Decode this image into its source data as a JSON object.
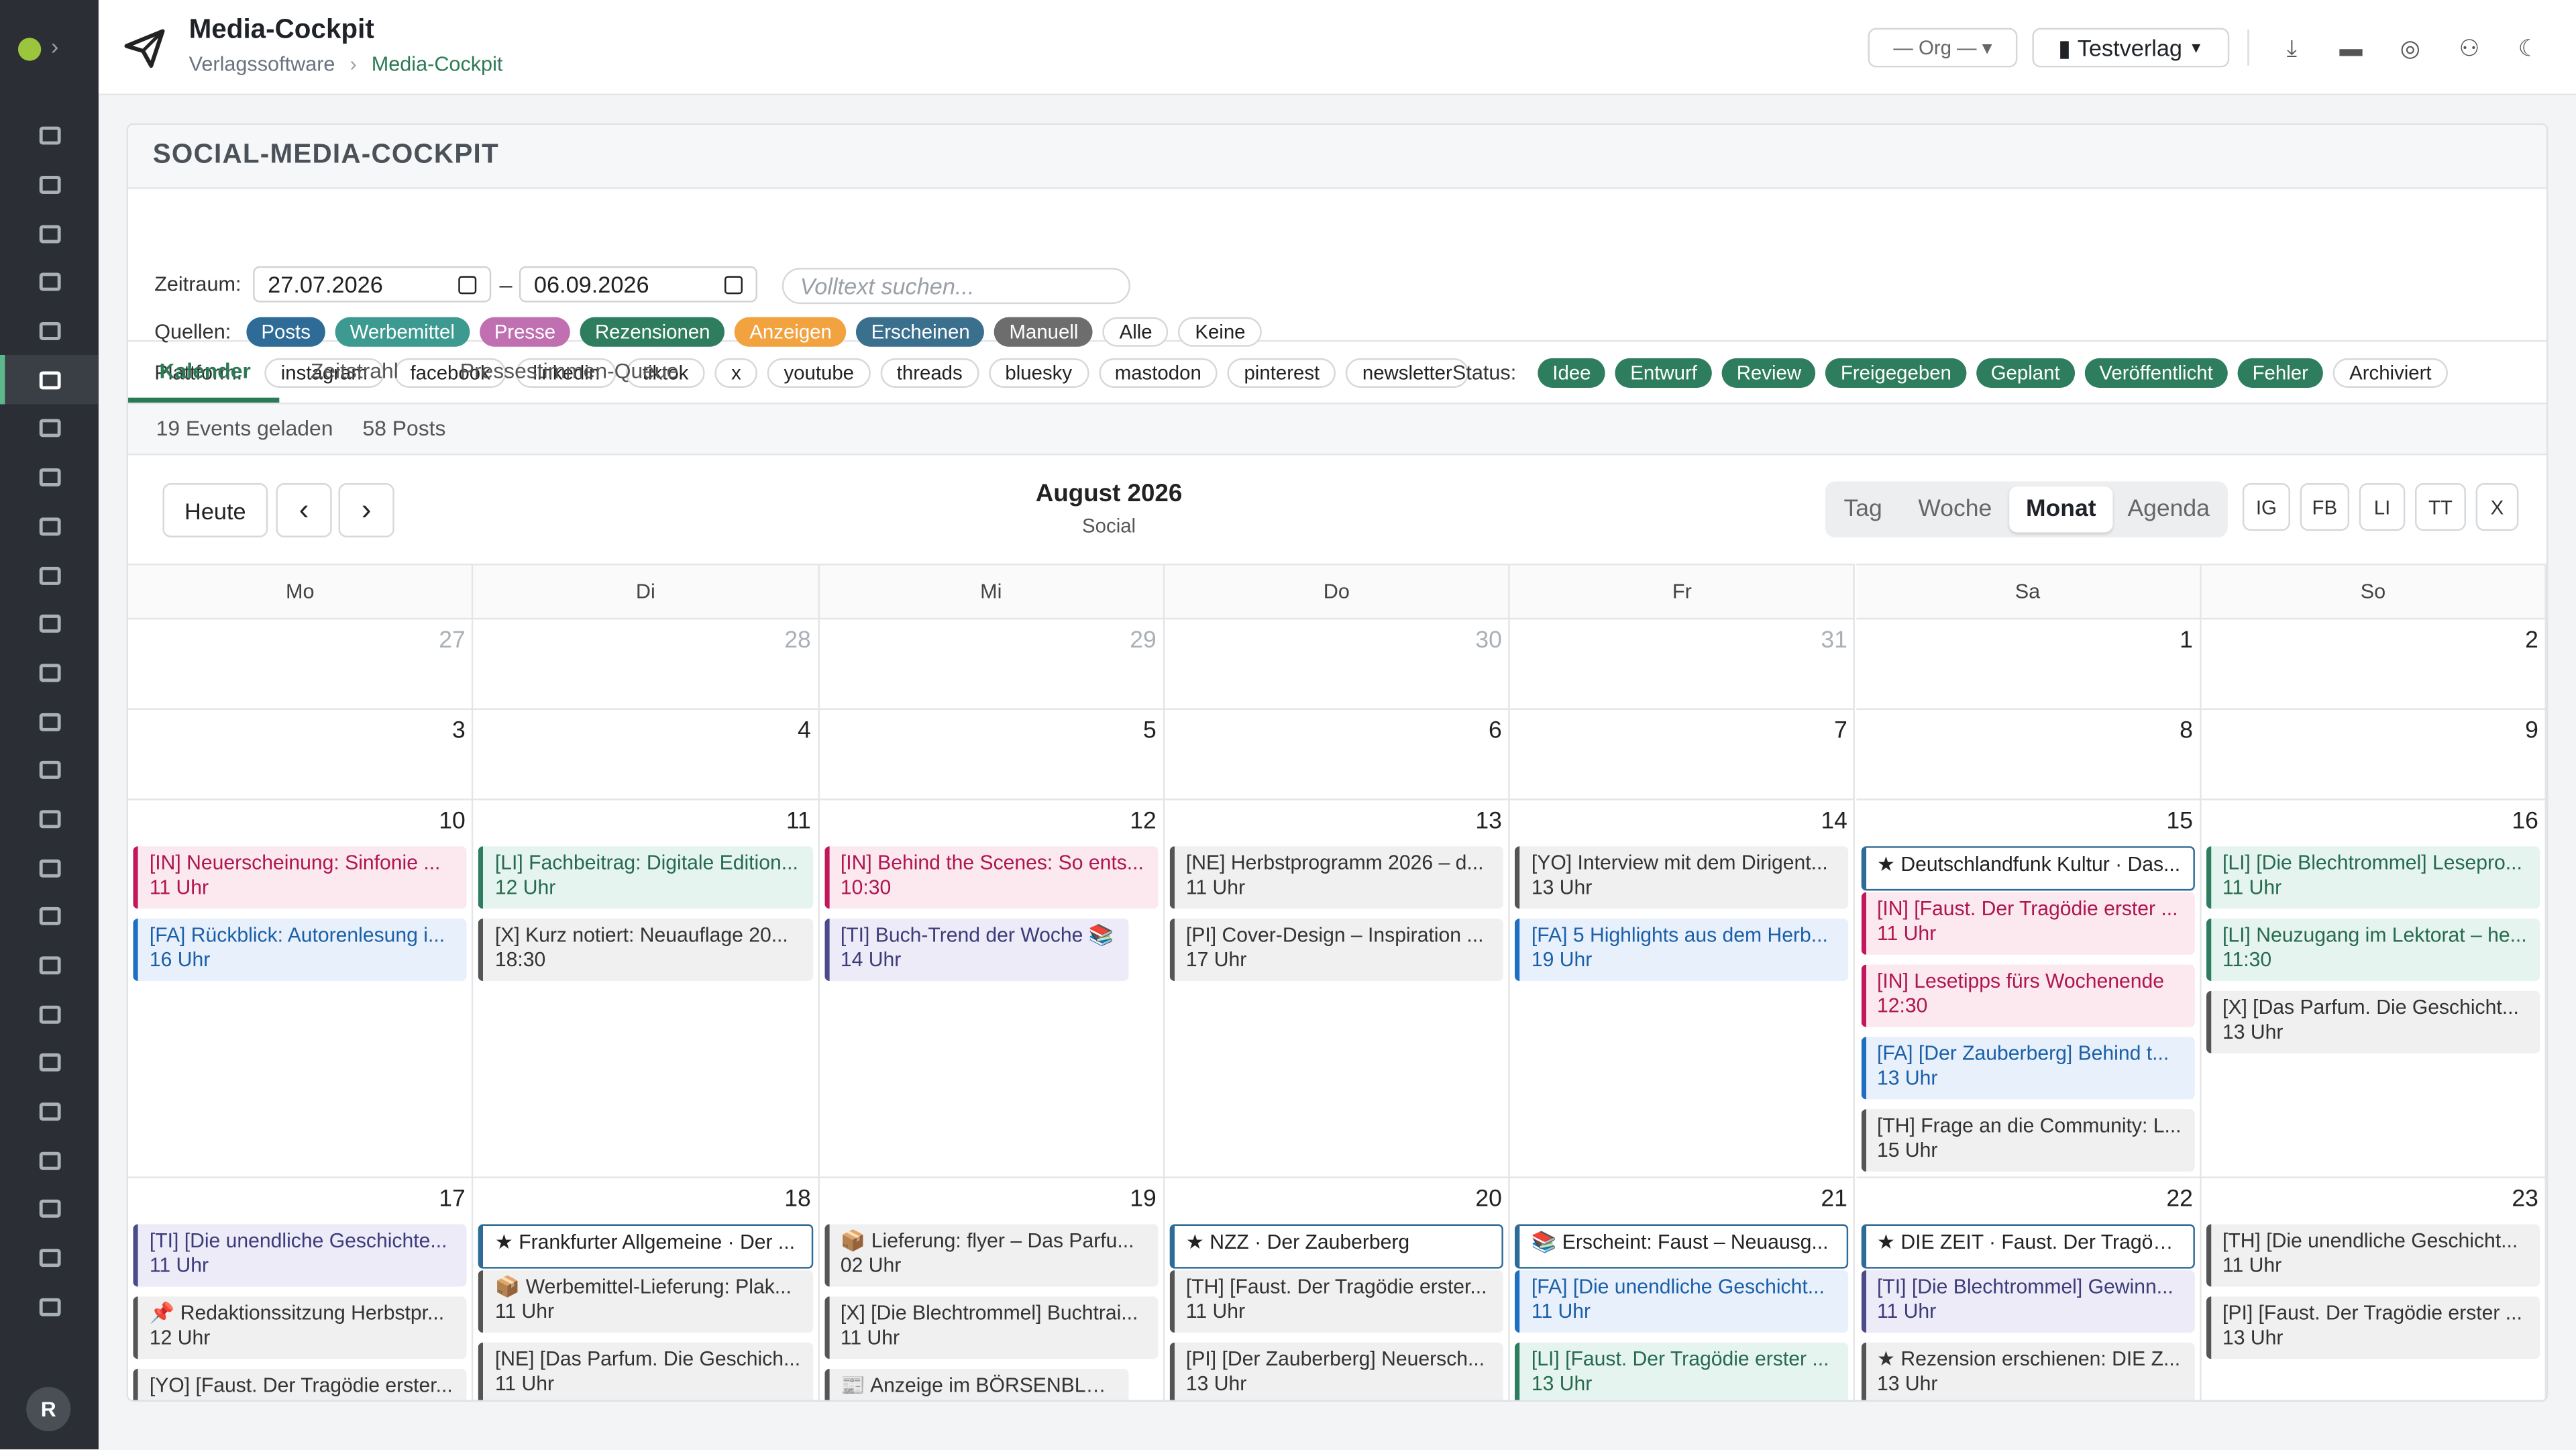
{
  "app": {
    "title": "Media-Cockpit",
    "breadcrumb": [
      "Verlagssoftware",
      "Media-Cockpit"
    ],
    "org_label": "— Org — ▾",
    "verlag_label": "Testverlag",
    "avatar": "R"
  },
  "card": {
    "title": "SOCIAL-MEDIA-COCKPIT"
  },
  "filters": {
    "zeitraum_label": "Zeitraum:",
    "date_from": "27.07.2026",
    "dash": "–",
    "date_to": "06.09.2026",
    "search_placeholder": "Volltext suchen...",
    "quellen_label": "Quellen:",
    "plattform_label": "Plattform:",
    "status_label": "Status:",
    "quellen": [
      {
        "label": "Posts",
        "color": "#2e6b96"
      },
      {
        "label": "Werbemittel",
        "color": "#3c9a90"
      },
      {
        "label": "Presse",
        "color": "#c06fb0"
      },
      {
        "label": "Rezensionen",
        "color": "#2f7d5f"
      },
      {
        "label": "Anzeigen",
        "color": "#f2a23f"
      },
      {
        "label": "Erscheinen",
        "color": "#3b6f8e"
      },
      {
        "label": "Manuell",
        "color": "#6d6d6d"
      }
    ],
    "quellen_extra": [
      "Alle",
      "Keine"
    ],
    "plattformen": [
      "instagram",
      "facebook",
      "linkedin",
      "tiktok",
      "x",
      "youtube",
      "threads",
      "bluesky",
      "mastodon",
      "pinterest",
      "newsletter"
    ],
    "status": [
      {
        "label": "Idee",
        "color": "#2f7d5f"
      },
      {
        "label": "Entwurf",
        "color": "#2f7d5f"
      },
      {
        "label": "Review",
        "color": "#2f7d5f"
      },
      {
        "label": "Freigegeben",
        "color": "#2f7d5f"
      },
      {
        "label": "Geplant",
        "color": "#2f7d5f"
      },
      {
        "label": "Veröffentlicht",
        "color": "#2f7d5f"
      },
      {
        "label": "Fehler",
        "color": "#2f7d5f"
      }
    ],
    "status_extra": [
      "Archiviert"
    ]
  },
  "tabs": [
    "Kalender",
    "Zeitstrahl",
    "Pressestimmen-Queue"
  ],
  "stats": {
    "events": "19 Events geladen",
    "posts": "58 Posts"
  },
  "calendar": {
    "today": "Heute",
    "prev": "‹",
    "next": "›",
    "month": "August 2026",
    "sub": "Social",
    "views": [
      "Tag",
      "Woche",
      "Monat",
      "Agenda"
    ],
    "platforms": [
      "IG",
      "FB",
      "LI",
      "TT",
      "X"
    ],
    "weekdays": [
      "Mo",
      "Di",
      "Mi",
      "Do",
      "Fr",
      "Sa",
      "So"
    ],
    "weeks": [
      [
        {
          "d": "27",
          "o": true
        },
        {
          "d": "28",
          "o": true
        },
        {
          "d": "29",
          "o": true
        },
        {
          "d": "30",
          "o": true
        },
        {
          "d": "31",
          "o": true
        },
        {
          "d": "1"
        },
        {
          "d": "2"
        }
      ],
      [
        {
          "d": "3"
        },
        {
          "d": "4"
        },
        {
          "d": "5"
        },
        {
          "d": "6"
        },
        {
          "d": "7"
        },
        {
          "d": "8"
        },
        {
          "d": "9"
        }
      ],
      [
        {
          "d": "10",
          "ev": [
            {
              "t": "[IN] Neuerscheinung: Sinfonie ...",
              "h": "11 Uhr",
              "c": "in"
            },
            {
              "t": "[FA] Rückblick: Autorenlesung i...",
              "h": "16 Uhr",
              "c": "fa"
            }
          ]
        },
        {
          "d": "11",
          "ev": [
            {
              "t": "[LI] Fachbeitrag: Digitale Edition...",
              "h": "12 Uhr",
              "c": "li"
            },
            {
              "t": "[X] Kurz notiert: Neuauflage 20...",
              "h": "18:30",
              "c": "gr"
            }
          ]
        },
        {
          "d": "12",
          "ev": [
            {
              "t": "[IN] Behind the Scenes: So ents...",
              "h": "10:30",
              "c": "in"
            },
            {
              "t": "[TI] Buch-Trend der Woche 📚",
              "h": "14 Uhr",
              "c": "ti",
              "w": 185
            }
          ]
        },
        {
          "d": "13",
          "ev": [
            {
              "t": "[NE] Herbstprogramm 2026 – d...",
              "h": "11 Uhr",
              "c": "gr"
            },
            {
              "t": "[PI] Cover-Design – Inspiration ...",
              "h": "17 Uhr",
              "c": "gr"
            }
          ]
        },
        {
          "d": "14",
          "ev": [
            {
              "t": "[YO] Interview mit dem Dirigent...",
              "h": "13 Uhr",
              "c": "gr"
            },
            {
              "t": "[FA] 5 Highlights aus dem Herb...",
              "h": "19 Uhr",
              "c": "fa"
            }
          ]
        },
        {
          "d": "15",
          "ev": [
            {
              "t": "★ Deutschlandfunk Kultur · Das...",
              "c": "hl"
            },
            {
              "t": "[IN] [Faust. Der Tragödie erster ...",
              "h": "11 Uhr",
              "c": "in"
            },
            {
              "t": "[IN] Lesetipps fürs Wochenende",
              "h": "12:30",
              "c": "in"
            },
            {
              "t": "[FA] [Der Zauberberg] Behind t...",
              "h": "13 Uhr",
              "c": "fa"
            },
            {
              "t": "[TH] Frage an die Community: L...",
              "h": "15 Uhr",
              "c": "gr"
            }
          ]
        },
        {
          "d": "16",
          "ev": [
            {
              "t": "[LI] [Die Blechtrommel] Lesepro...",
              "h": "11 Uhr",
              "c": "li"
            },
            {
              "t": "[LI] Neuzugang im Lektorat – he...",
              "h": "11:30",
              "c": "li"
            },
            {
              "t": "[X] [Das Parfum. Die Geschicht...",
              "h": "13 Uhr",
              "c": "gr"
            }
          ]
        }
      ],
      [
        {
          "d": "17",
          "ev": [
            {
              "t": "[TI] [Die unendliche Geschichte...",
              "h": "11 Uhr",
              "c": "ti"
            },
            {
              "t": "📌 Redaktionssitzung Herbstpr...",
              "h": "12 Uhr",
              "c": "gr"
            },
            {
              "t": "[YO] [Faust. Der Tragödie erster...",
              "h": "",
              "c": "gr"
            }
          ]
        },
        {
          "d": "18",
          "ev": [
            {
              "t": "★ Frankfurter Allgemeine · Der ...",
              "c": "hl"
            },
            {
              "t": "📦 Werbemittel-Lieferung: Plak...",
              "h": "11 Uhr",
              "c": "gr"
            },
            {
              "t": "[NE] [Das Parfum. Die Geschich...",
              "h": "11 Uhr",
              "c": "gr"
            }
          ]
        },
        {
          "d": "19",
          "ev": [
            {
              "t": "📦 Lieferung: flyer – Das Parfu...",
              "h": "02 Uhr",
              "c": "gr"
            },
            {
              "t": "[X] [Die Blechtrommel] Buchtrai...",
              "h": "11 Uhr",
              "c": "gr"
            },
            {
              "t": "📰 Anzeige im BÖRSENBLATT",
              "h": "",
              "c": "gr",
              "w": 185
            }
          ]
        },
        {
          "d": "20",
          "ev": [
            {
              "t": "★ NZZ · Der Zauberberg",
              "c": "hl"
            },
            {
              "t": "[TH] [Faust. Der Tragödie erster...",
              "h": "11 Uhr",
              "c": "gr"
            },
            {
              "t": "[PI] [Der Zauberberg] Neuersch...",
              "h": "13 Uhr",
              "c": "gr"
            }
          ]
        },
        {
          "d": "21",
          "ev": [
            {
              "t": "📚 Erscheint: Faust – Neuausg...",
              "c": "hl"
            },
            {
              "t": "[FA] [Die unendliche Geschicht...",
              "h": "11 Uhr",
              "c": "fa"
            },
            {
              "t": "[LI] [Faust. Der Tragödie erster ...",
              "h": "13 Uhr",
              "c": "li"
            }
          ]
        },
        {
          "d": "22",
          "ev": [
            {
              "t": "★ DIE ZEIT · Faust. Der Tragödi...",
              "c": "hl"
            },
            {
              "t": "[TI] [Die Blechtrommel] Gewinn...",
              "h": "11 Uhr",
              "c": "ti"
            },
            {
              "t": "★ Rezension erschienen: DIE Z...",
              "h": "13 Uhr",
              "c": "gr"
            }
          ]
        },
        {
          "d": "23",
          "ev": [
            {
              "t": "[TH] [Die unendliche Geschicht...",
              "h": "11 Uhr",
              "c": "gr"
            },
            {
              "t": "[PI] [Faust. Der Tragödie erster ...",
              "h": "13 Uhr",
              "c": "gr"
            }
          ]
        }
      ]
    ]
  },
  "event_styles": {
    "in": {
      "bg": "#fbe9ef",
      "border": "#c2185b",
      "text": "#b0154f"
    },
    "fa": {
      "bg": "#e8f1fb",
      "border": "#1e6fc4",
      "text": "#1a5fa8"
    },
    "li": {
      "bg": "#e6f4ef",
      "border": "#2f7d5f",
      "text": "#256a4f"
    },
    "ti": {
      "bg": "#ecebf7",
      "border": "#4b4a8a",
      "text": "#3d3c7a"
    },
    "gr": {
      "bg": "#f0f0f0",
      "border": "#555555",
      "text": "#333333"
    },
    "hl": {
      "bg": "#ffffff",
      "border": "#2e6b96",
      "text": "#222222"
    }
  }
}
